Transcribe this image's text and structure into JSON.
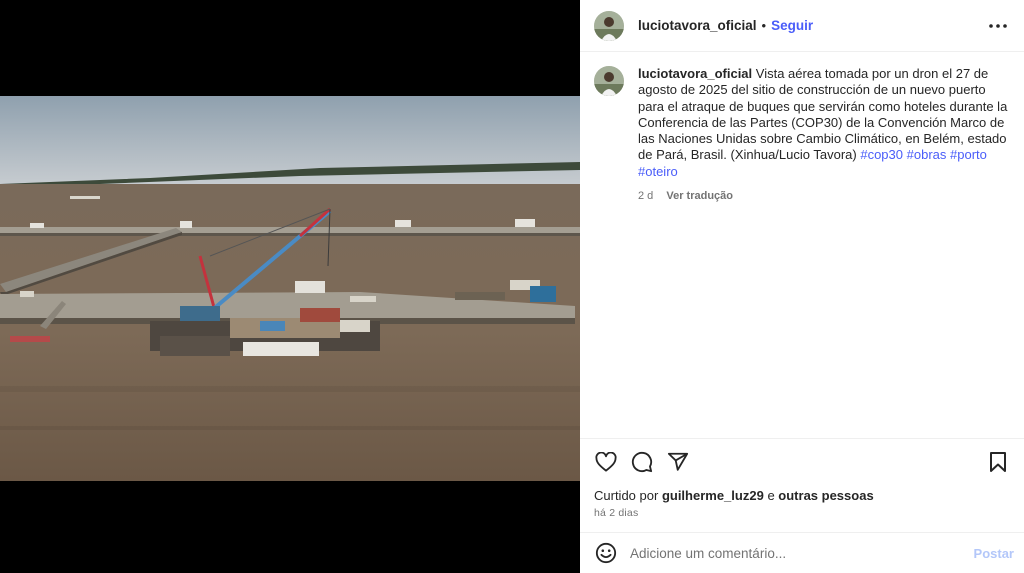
{
  "post": {
    "username": "luciotavora_oficial",
    "separator": "•",
    "follow_label": "Seguir",
    "more_icon": "more-options-icon",
    "photo_alt": "Vista aérea de un puerto en construcción sobre un río",
    "caption": {
      "username": "luciotavora_oficial",
      "text": "Vista aérea tomada por un dron el 27 de agosto de 2025 del sitio de construcción de un nuevo puerto para el atraque de buques que servirán como hoteles durante la Conferencia de las Partes (COP30) de la Convención Marco de las Naciones Unidas sobre Cambio Climático, en Belém, estado de Pará, Brasil. (Xinhua/Lucio Tavora)",
      "hashtags": [
        "#cop30",
        "#obras",
        "#porto",
        "#oteiro"
      ],
      "age": "2 d",
      "translate_label": "Ver tradução"
    },
    "actions": {
      "like_icon": "heart-icon",
      "comment_icon": "comment-icon",
      "share_icon": "share-icon",
      "save_icon": "bookmark-icon"
    },
    "likes": {
      "prefix": "Curtido por",
      "user": "guilherme_luz29",
      "joiner": "e",
      "others": "outras pessoas"
    },
    "timestamp": "há 2 dias",
    "comment": {
      "placeholder": "Adicione um comentário...",
      "post_label": "Postar",
      "emoji_icon": "emoji-icon"
    }
  },
  "colors": {
    "link": "#4a5df9",
    "post_disabled": "#b3c7f9",
    "muted": "#737373"
  }
}
